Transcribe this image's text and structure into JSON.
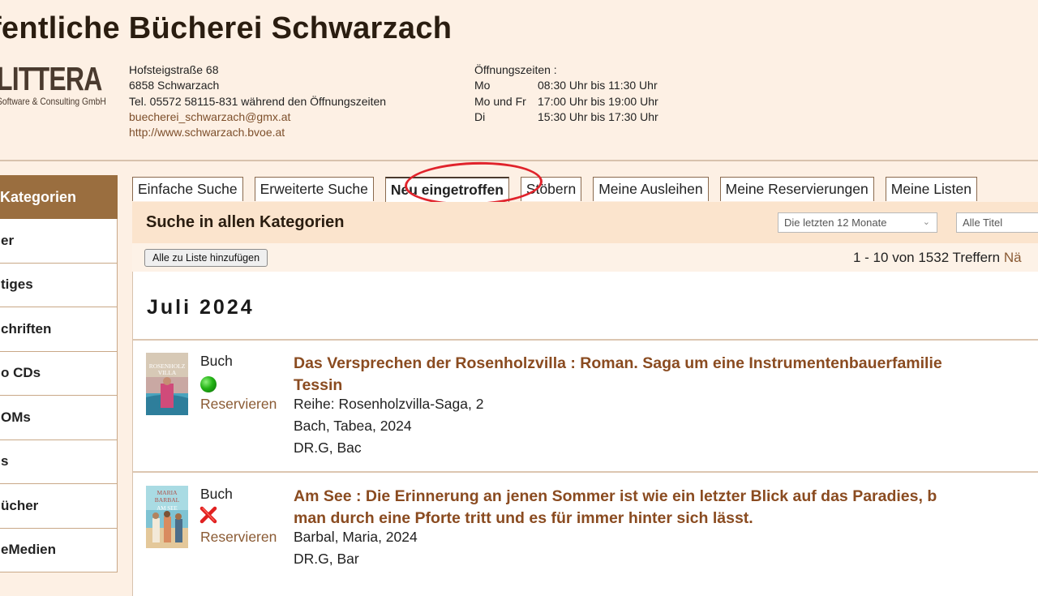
{
  "header": {
    "title": "ffentliche Bücherei Schwarzach",
    "logo_main": "LITTERA",
    "logo_sub": "Software & Consulting GmbH",
    "address": {
      "street": "Hofsteigstraße 68",
      "city": "6858 Schwarzach",
      "phone": "Tel. 05572 58115-831 während den Öffnungszeiten",
      "email": "buecherei_schwarzach@gmx.at",
      "website": "http://www.schwarzach.bvoe.at"
    },
    "hours": {
      "label": "Öffnungszeiten :",
      "rows": [
        {
          "day": "Mo",
          "time": "08:30 Uhr bis 11:30 Uhr"
        },
        {
          "day": "Mo und Fr",
          "time": "17:00 Uhr bis 19:00 Uhr"
        },
        {
          "day": "Di",
          "time": "15:30 Uhr bis 17:30 Uhr"
        }
      ]
    }
  },
  "sidebar": {
    "head": "Kategorien",
    "items": [
      {
        "label": "er"
      },
      {
        "label": "tiges"
      },
      {
        "label": "chriften"
      },
      {
        "label": "o CDs"
      },
      {
        "label": "OMs"
      },
      {
        "label": "s"
      },
      {
        "label": "ücher"
      },
      {
        "label": "eMedien"
      }
    ]
  },
  "tabs": [
    {
      "label": "Einfache Suche"
    },
    {
      "label": "Erweiterte Suche"
    },
    {
      "label": "Neu eingetroffen"
    },
    {
      "label": "Stöbern"
    },
    {
      "label": "Meine Ausleihen"
    },
    {
      "label": "Meine Reservierungen"
    },
    {
      "label": "Meine Listen"
    }
  ],
  "search": {
    "title": "Suche in allen Kategorien",
    "period_select": "Die letzten 12 Monate",
    "filter_select": "Alle Titel",
    "add_all_label": "Alle zu Liste hinzufügen",
    "result_count": "1 - 10 von 1532 Treffern",
    "next_label": "Nä"
  },
  "results": {
    "month": "Juli 2024",
    "items": [
      {
        "type": "Buch",
        "status": "available",
        "reserve": "Reservieren",
        "title": "Das Versprechen der Rosenholzvilla : Roman. Saga um eine Instrumentenbauerfamilie",
        "title_cont": "Tessin",
        "meta": [
          "Reihe: Rosenholzvilla-Saga, 2",
          "Bach, Tabea, 2024",
          "DR.G, Bac"
        ],
        "cover_text": "ROSENHOLZ VILLA"
      },
      {
        "type": "Buch",
        "status": "unavailable",
        "reserve": "Reservieren",
        "title": "Am See : Die Erinnerung an jenen Sommer ist wie ein letzter Blick auf das Paradies, b",
        "title_cont": "man durch eine Pforte tritt und es für immer hinter sich lässt.",
        "meta": [
          "Barbal, Maria, 2024",
          "DR.G, Bar"
        ],
        "cover_text": "MARIA BARBAL AM SEE"
      }
    ]
  },
  "colors": {
    "page_bg": "#fdf0e4",
    "accent": "#9a6e3f",
    "link": "#8a5a33",
    "title": "#8a4b20",
    "annotation": "#e0232b"
  }
}
